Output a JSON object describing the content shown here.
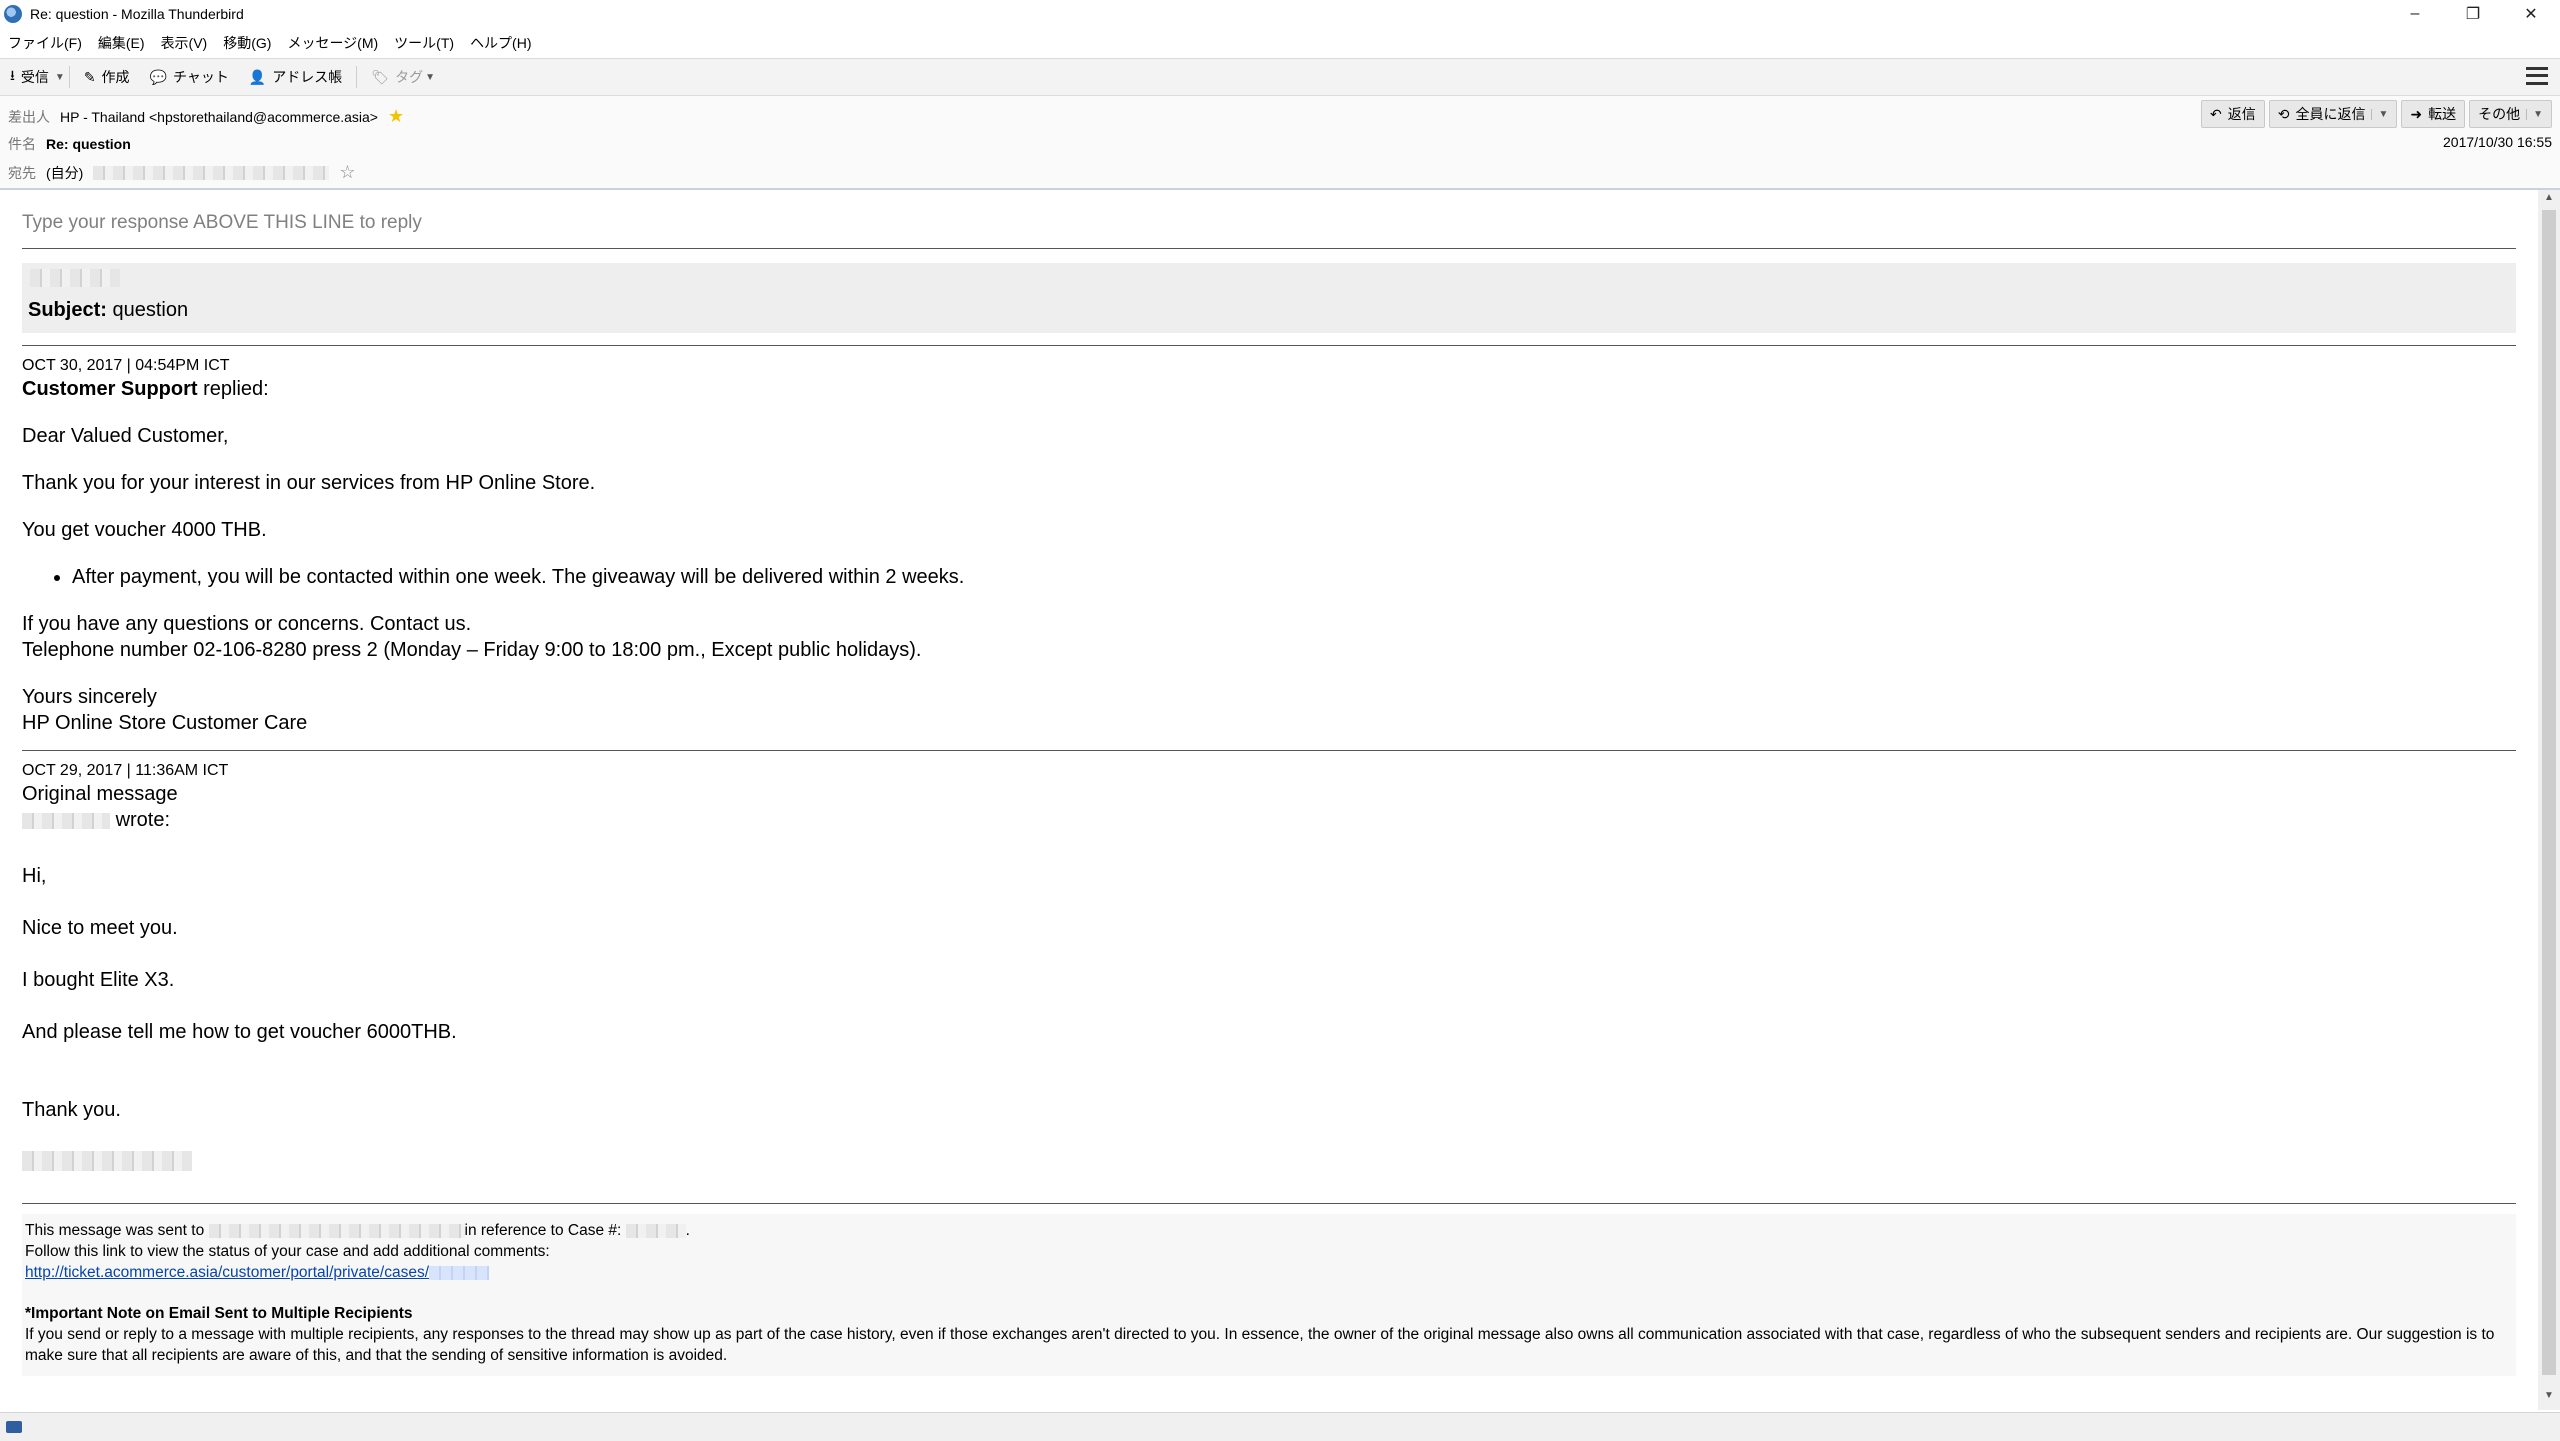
{
  "window": {
    "title": "Re: question - Mozilla Thunderbird",
    "controls": [
      "–",
      "❐",
      "✕"
    ]
  },
  "menubar": [
    "ファイル(F)",
    "編集(E)",
    "表示(V)",
    "移動(G)",
    "メッセージ(M)",
    "ツール(T)",
    "ヘルプ(H)"
  ],
  "toolbar": {
    "get_mail": "受信",
    "write": "作成",
    "chat": "チャット",
    "address_book": "アドレス帳",
    "tag": "タグ"
  },
  "header": {
    "from_label": "差出人",
    "from_value": "HP - Thailand <hpstorethailand@acommerce.asia>",
    "subject_label": "件名",
    "subject_value": "Re: question",
    "to_label": "宛先",
    "to_value": "(自分)",
    "date": "2017/10/30 16:55",
    "buttons": {
      "reply": "返信",
      "reply_all": "全員に返信",
      "forward": "転送",
      "other": "その他"
    }
  },
  "body": {
    "reply_line": "Type your response ABOVE THIS LINE to reply",
    "subject_label": "Subject:",
    "subject_value": "question",
    "msg1": {
      "timestamp": "OCT 30, 2017  |  04:54PM ICT",
      "author": "Customer Support",
      "action": "replied:",
      "greeting": "Dear Valued Customer,",
      "p1": "Thank you for your interest in our services from HP Online Store.",
      "p2": "You get voucher 4000 THB.",
      "bullet": "After payment, you will be contacted within one week. The giveaway will be delivered within 2 weeks.",
      "p3": "If you have any questions or concerns. Contact us.",
      "p4": "Telephone number 02-106-8280 press 2 (Monday – Friday 9:00 to 18:00 pm., Except public holidays).",
      "sign1": "Yours sincerely",
      "sign2": "HP Online Store Customer Care"
    },
    "msg2": {
      "timestamp": "OCT 29, 2017  |  11:36AM ICT",
      "label": "Original message",
      "wrote": "wrote:",
      "l1": "Hi,",
      "l2": "Nice to meet you.",
      "l3": "I bought Elite X3.",
      "l4": "And please tell me how to get voucher 6000THB.",
      "l5": "Thank you."
    },
    "footer": {
      "sent_to": "This message was sent to",
      "in_ref": "in reference to Case #:",
      "follow": "Follow this link to view the status of your case and add additional comments:",
      "link": "http://ticket.acommerce.asia/customer/portal/private/cases/",
      "note_title": "*Important Note on Email Sent to Multiple Recipients",
      "note_text": "If you send or reply to a message with multiple recipients, any responses to the thread may show up as part of the case history, even if those exchanges aren't directed to you. In essence, the owner of the original message also owns all communication associated with that case, regardless of who the subsequent senders and recipients are. Our suggestion is to make sure that all recipients are aware of this, and that the sending of sensitive information is avoided."
    }
  }
}
